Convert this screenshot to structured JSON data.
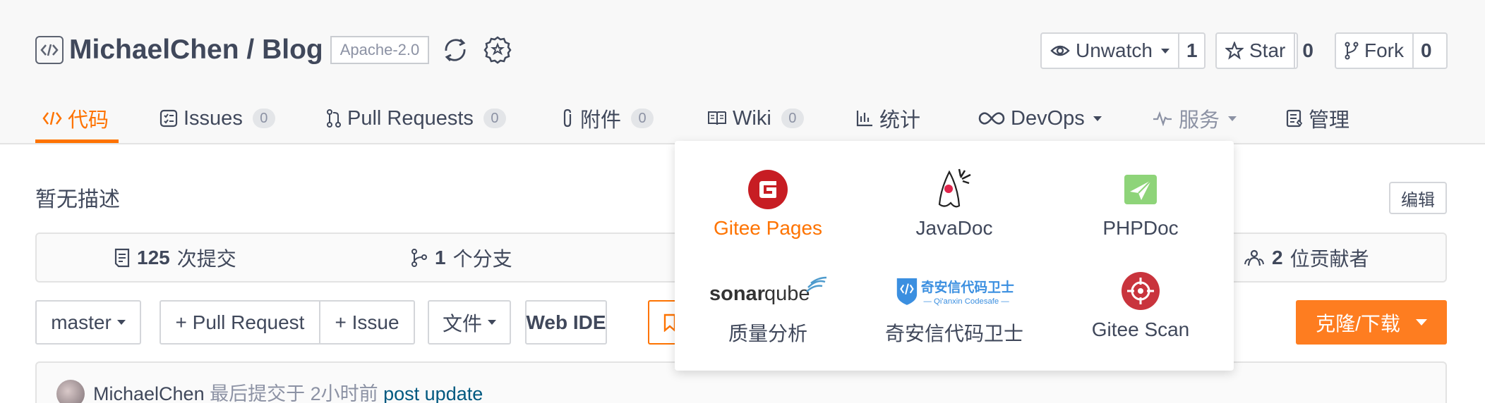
{
  "repo": {
    "owner": "MichaelChen",
    "separator": " / ",
    "name": "Blog",
    "license": "Apache-2.0",
    "icons": [
      "code-icon",
      "sync-icon",
      "award-icon"
    ]
  },
  "actions": {
    "watch": {
      "label": "Unwatch",
      "count": "1",
      "icon": "eye-icon"
    },
    "star": {
      "label": "Star",
      "count": "0",
      "icon": "star-icon"
    },
    "fork": {
      "label": "Fork",
      "count": "0",
      "icon": "fork-icon"
    }
  },
  "tabs": [
    {
      "label": "代码",
      "icon": "code-icon",
      "active": true
    },
    {
      "label": "Issues",
      "count": "0",
      "icon": "issues-icon"
    },
    {
      "label": "Pull Requests",
      "count": "0",
      "icon": "pull-request-icon"
    },
    {
      "label": "附件",
      "count": "0",
      "icon": "paperclip-icon"
    },
    {
      "label": "Wiki",
      "count": "0",
      "icon": "book-icon"
    },
    {
      "label": "统计",
      "icon": "bar-chart-icon"
    },
    {
      "label": "DevOps",
      "icon": "infinity-icon"
    },
    {
      "label": "服务",
      "icon": "pulse-icon"
    },
    {
      "label": "管理",
      "icon": "clipboard-icon"
    }
  ],
  "description": "暂无描述",
  "edit_label": "编辑",
  "stats": {
    "commits": {
      "count": "125",
      "label": "次提交"
    },
    "branches": {
      "count": "1",
      "label": "个分支"
    },
    "contributors": {
      "count": "2",
      "label": "位贡献者"
    }
  },
  "toolbar": {
    "branch": "master",
    "pull_request": "+ Pull Request",
    "issue": "+ Issue",
    "file": "文件",
    "web_ide": "Web IDE",
    "clone": "克隆/下载"
  },
  "commit": {
    "user": "MichaelChen",
    "text": " 最后提交于 2小时前 ",
    "message": "post update"
  },
  "services_menu": [
    {
      "label": "Gitee Pages",
      "logo": "gitee-logo",
      "highlight": true
    },
    {
      "label": "JavaDoc",
      "logo": "duke-logo"
    },
    {
      "label": "PHPDoc",
      "logo": "phpdoc-logo"
    },
    {
      "label": "质量分析",
      "logo": "sonarqube-logo"
    },
    {
      "label": "奇安信代码卫士",
      "logo": "qianxin-codesafe-logo",
      "logo_text": "奇安信代码卫士",
      "logo_subtext": "— Qi'anxin Codesafe —"
    },
    {
      "label": "Gitee Scan",
      "logo": "gitee-scan-logo"
    }
  ],
  "colors": {
    "accent": "#fe7300",
    "text": "#40485b",
    "muted": "#8c92a4",
    "gitee_red": "#c71d23"
  }
}
